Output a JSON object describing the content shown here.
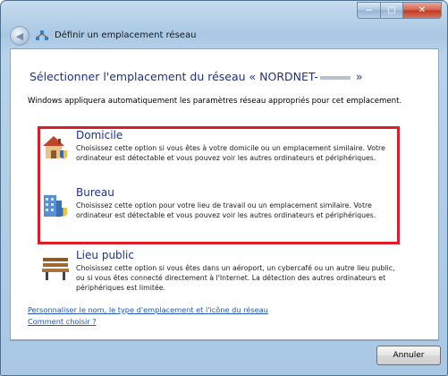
{
  "window": {
    "title": "Définir un emplacement réseau",
    "min_glyph": "‒",
    "max_glyph": "□",
    "close_glyph": "✕"
  },
  "heading": {
    "prefix": "Sélectionner l'emplacement du réseau « NORDNET-",
    "suffix": " »"
  },
  "description": "Windows appliquera automatiquement les paramètres réseau appropriés pour cet emplacement.",
  "options": [
    {
      "title": "Domicile",
      "text": "Choisissez cette option si vous êtes à votre domicile ou un emplacement similaire. Votre ordinateur est détectable et vous pouvez voir les autres ordinateurs et périphériques.",
      "icon": "house-icon"
    },
    {
      "title": "Bureau",
      "text": "Choisissez cette option pour votre lieu de travail ou un emplacement similaire. Votre ordinateur est détectable et vous pouvez voir les autres ordinateurs et périphériques.",
      "icon": "office-building-icon"
    },
    {
      "title": "Lieu public",
      "text": "Choisissez cette option si vous êtes dans un aéroport, un cybercafé ou un autre lieu public, ou si vous êtes connecté directement à l'Internet. La détection des autres ordinateurs et périphériques est limitée.",
      "icon": "park-bench-icon"
    }
  ],
  "links": {
    "customize": "Personnaliser le nom, le type d'emplacement et l'icône du réseau",
    "help": "Comment choisir ?"
  },
  "buttons": {
    "cancel": "Annuler"
  },
  "colors": {
    "highlight": "#e01b2a",
    "heading": "#1e3287",
    "link": "#1f56b8"
  }
}
